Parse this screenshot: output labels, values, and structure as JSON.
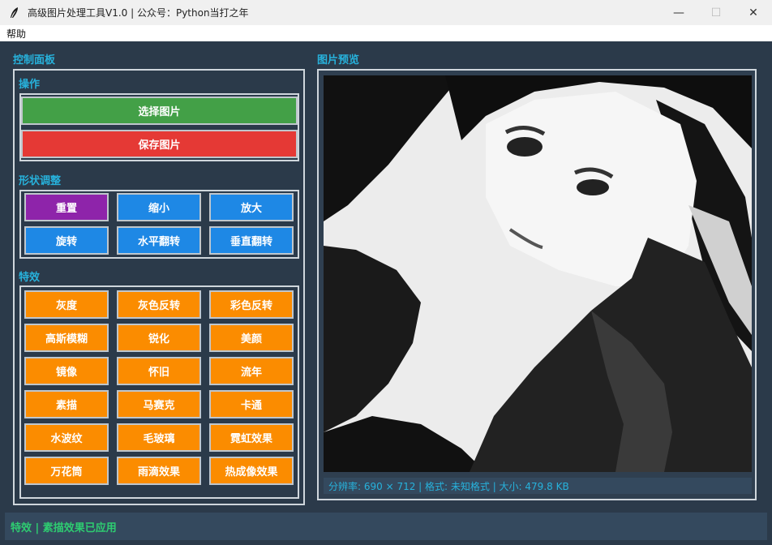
{
  "window": {
    "title": "高级图片处理工具V1.0 | 公众号：Python当打之年",
    "minimize": "—",
    "maximize": "☐",
    "close": "✕"
  },
  "menu": {
    "items": [
      "帮助"
    ]
  },
  "control_panel": {
    "title": "控制面板",
    "operations": {
      "title": "操作",
      "select_label": "选择图片",
      "save_label": "保存图片"
    },
    "shape": {
      "title": "形状调整",
      "buttons": [
        "重置",
        "缩小",
        "放大",
        "旋转",
        "水平翻转",
        "垂直翻转"
      ]
    },
    "effects": {
      "title": "特效",
      "buttons": [
        "灰度",
        "灰色反转",
        "彩色反转",
        "高斯模糊",
        "锐化",
        "美颜",
        "镜像",
        "怀旧",
        "流年",
        "素描",
        "马赛克",
        "卡通",
        "水波纹",
        "毛玻璃",
        "霓虹效果",
        "万花筒",
        "雨滴效果",
        "热成像效果"
      ]
    }
  },
  "preview": {
    "title": "图片预览",
    "info": "分辨率: 690 × 712 | 格式: 未知格式 | 大小: 479.8 KB"
  },
  "status": {
    "text": "特效 | 素描效果已应用"
  },
  "colors": {
    "background": "#2b3a4a",
    "accent": "#27b2dc",
    "status": "#2ecc71",
    "green": "#43a047",
    "red": "#e53935",
    "purple": "#8e24aa",
    "blue": "#1e88e5",
    "orange": "#fb8c00"
  }
}
